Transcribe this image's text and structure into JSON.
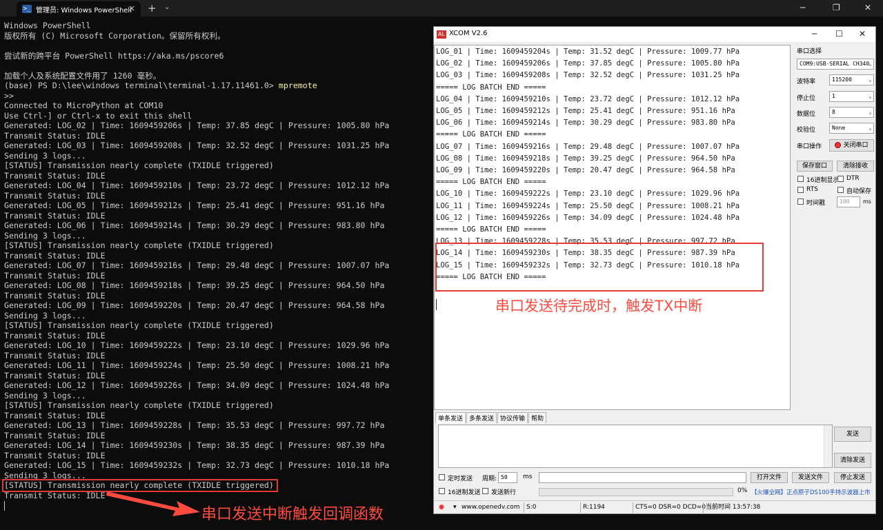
{
  "terminal": {
    "tab_title": "管理员: Windows PowerShell",
    "lines": [
      "Windows PowerShell",
      "版权所有 (C) Microsoft Corporation。保留所有权利。",
      "",
      "尝试新的跨平台 PowerShell https://aka.ms/pscore6",
      "",
      "加载个人及系统配置文件用了 1260 毫秒。",
      "(base) PS D:\\lee\\windows terminal\\terminal-1.17.11461.0> ",
      ">>",
      "Connected to MicroPython at COM10",
      "Use Ctrl-] or Ctrl-x to exit this shell",
      "Generated: LOG_02 | Time: 1609459206s | Temp: 37.85 degC | Pressure: 1005.80 hPa",
      "Transmit Status: IDLE",
      "Generated: LOG_03 | Time: 1609459208s | Temp: 32.52 degC | Pressure: 1031.25 hPa",
      "Sending 3 logs...",
      "[STATUS] Transmission nearly complete (TXIDLE triggered)",
      "Transmit Status: IDLE",
      "Generated: LOG_04 | Time: 1609459210s | Temp: 23.72 degC | Pressure: 1012.12 hPa",
      "Transmit Status: IDLE",
      "Generated: LOG_05 | Time: 1609459212s | Temp: 25.41 degC | Pressure: 951.16 hPa",
      "Transmit Status: IDLE",
      "Generated: LOG_06 | Time: 1609459214s | Temp: 30.29 degC | Pressure: 983.80 hPa",
      "Sending 3 logs...",
      "[STATUS] Transmission nearly complete (TXIDLE triggered)",
      "Transmit Status: IDLE",
      "Generated: LOG_07 | Time: 1609459216s | Temp: 29.48 degC | Pressure: 1007.07 hPa",
      "Transmit Status: IDLE",
      "Generated: LOG_08 | Time: 1609459218s | Temp: 39.25 degC | Pressure: 964.50 hPa",
      "Transmit Status: IDLE",
      "Generated: LOG_09 | Time: 1609459220s | Temp: 20.47 degC | Pressure: 964.58 hPa",
      "Sending 3 logs...",
      "[STATUS] Transmission nearly complete (TXIDLE triggered)",
      "Transmit Status: IDLE",
      "Generated: LOG_10 | Time: 1609459222s | Temp: 23.10 degC | Pressure: 1029.96 hPa",
      "Transmit Status: IDLE",
      "Generated: LOG_11 | Time: 1609459224s | Temp: 25.50 degC | Pressure: 1008.21 hPa",
      "Transmit Status: IDLE",
      "Generated: LOG_12 | Time: 1609459226s | Temp: 34.09 degC | Pressure: 1024.48 hPa",
      "Sending 3 logs...",
      "[STATUS] Transmission nearly complete (TXIDLE triggered)",
      "Transmit Status: IDLE",
      "Generated: LOG_13 | Time: 1609459228s | Temp: 35.53 degC | Pressure: 997.72 hPa",
      "Transmit Status: IDLE",
      "Generated: LOG_14 | Time: 1609459230s | Temp: 38.35 degC | Pressure: 987.39 hPa",
      "Transmit Status: IDLE",
      "Generated: LOG_15 | Time: 1609459232s | Temp: 32.73 degC | Pressure: 1010.18 hPa",
      "Sending 3 logs...",
      "[STATUS] Transmission nearly complete (TXIDLE triggered)",
      "Transmit Status: IDLE"
    ],
    "command": "mpremote",
    "annotation": "串口发送中断触发回调函数"
  },
  "xcom": {
    "title": "XCOM V2.6",
    "logo_text": "ALIENTEK",
    "receive_lines": [
      "LOG_01 | Time: 1609459204s | Temp: 31.52 degC | Pressure: 1009.77 hPa",
      "LOG_02 | Time: 1609459206s | Temp: 37.85 degC | Pressure: 1005.80 hPa",
      "LOG_03 | Time: 1609459208s | Temp: 32.52 degC | Pressure: 1031.25 hPa",
      "===== LOG BATCH END =====",
      "LOG_04 | Time: 1609459210s | Temp: 23.72 degC | Pressure: 1012.12 hPa",
      "LOG_05 | Time: 1609459212s | Temp: 25.41 degC | Pressure: 951.16 hPa",
      "LOG_06 | Time: 1609459214s | Temp: 30.29 degC | Pressure: 983.80 hPa",
      "===== LOG BATCH END =====",
      "LOG_07 | Time: 1609459216s | Temp: 29.48 degC | Pressure: 1007.07 hPa",
      "LOG_08 | Time: 1609459218s | Temp: 39.25 degC | Pressure: 964.50 hPa",
      "LOG_09 | Time: 1609459220s | Temp: 20.47 degC | Pressure: 964.58 hPa",
      "===== LOG BATCH END =====",
      "LOG_10 | Time: 1609459222s | Temp: 23.10 degC | Pressure: 1029.96 hPa",
      "LOG_11 | Time: 1609459224s | Temp: 25.50 degC | Pressure: 1008.21 hPa",
      "LOG_12 | Time: 1609459226s | Temp: 34.09 degC | Pressure: 1024.48 hPa",
      "===== LOG BATCH END =====",
      "LOG_13 | Time: 1609459228s | Temp: 35.53 degC | Pressure: 997.72 hPa",
      "LOG_14 | Time: 1609459230s | Temp: 38.35 degC | Pressure: 987.39 hPa",
      "LOG_15 | Time: 1609459232s | Temp: 32.73 degC | Pressure: 1010.18 hPa",
      "===== LOG BATCH END ====="
    ],
    "annotation": "串口发送待完成时，触发TX中断",
    "panel": {
      "port_label": "串口选择",
      "port_value": "COM9:USB-SERIAL CH340",
      "baud_label": "波特率",
      "baud_value": "115200",
      "stop_label": "停止位",
      "stop_value": "1",
      "data_label": "数据位",
      "data_value": "8",
      "parity_label": "校验位",
      "parity_value": "None",
      "op_label": "串口操作",
      "close_port": "关闭串口",
      "save_window": "保存窗口",
      "clear_recv": "清除接收",
      "hex_display": "16进制显示",
      "dtr": "DTR",
      "rts": "RTS",
      "auto_save": "自动保存",
      "timestamp": "时间戳",
      "timestamp_value": "100",
      "timestamp_unit": "ms"
    },
    "tabs": [
      "单条发送",
      "多条发送",
      "协议传输",
      "帮助"
    ],
    "send_btn": "发送",
    "clear_send_btn": "清除发送",
    "timed_send": "定时发送",
    "period_label": "周期:",
    "period_value": "50",
    "period_unit": "ms",
    "open_file": "打开文件",
    "send_file": "发送文件",
    "stop_send": "停止发送",
    "hex_send": "16进制发送",
    "newline_send": "发送新行",
    "progress": "0%",
    "ad_text": "【火爆全网】正点原子DS100手持示波器上市",
    "status": {
      "url": "www.openedv.com",
      "s": "S:0",
      "r": "R:1194",
      "lines": "CTS=0 DSR=0 DCD=0",
      "time": "当前时间 13:57:38"
    }
  }
}
